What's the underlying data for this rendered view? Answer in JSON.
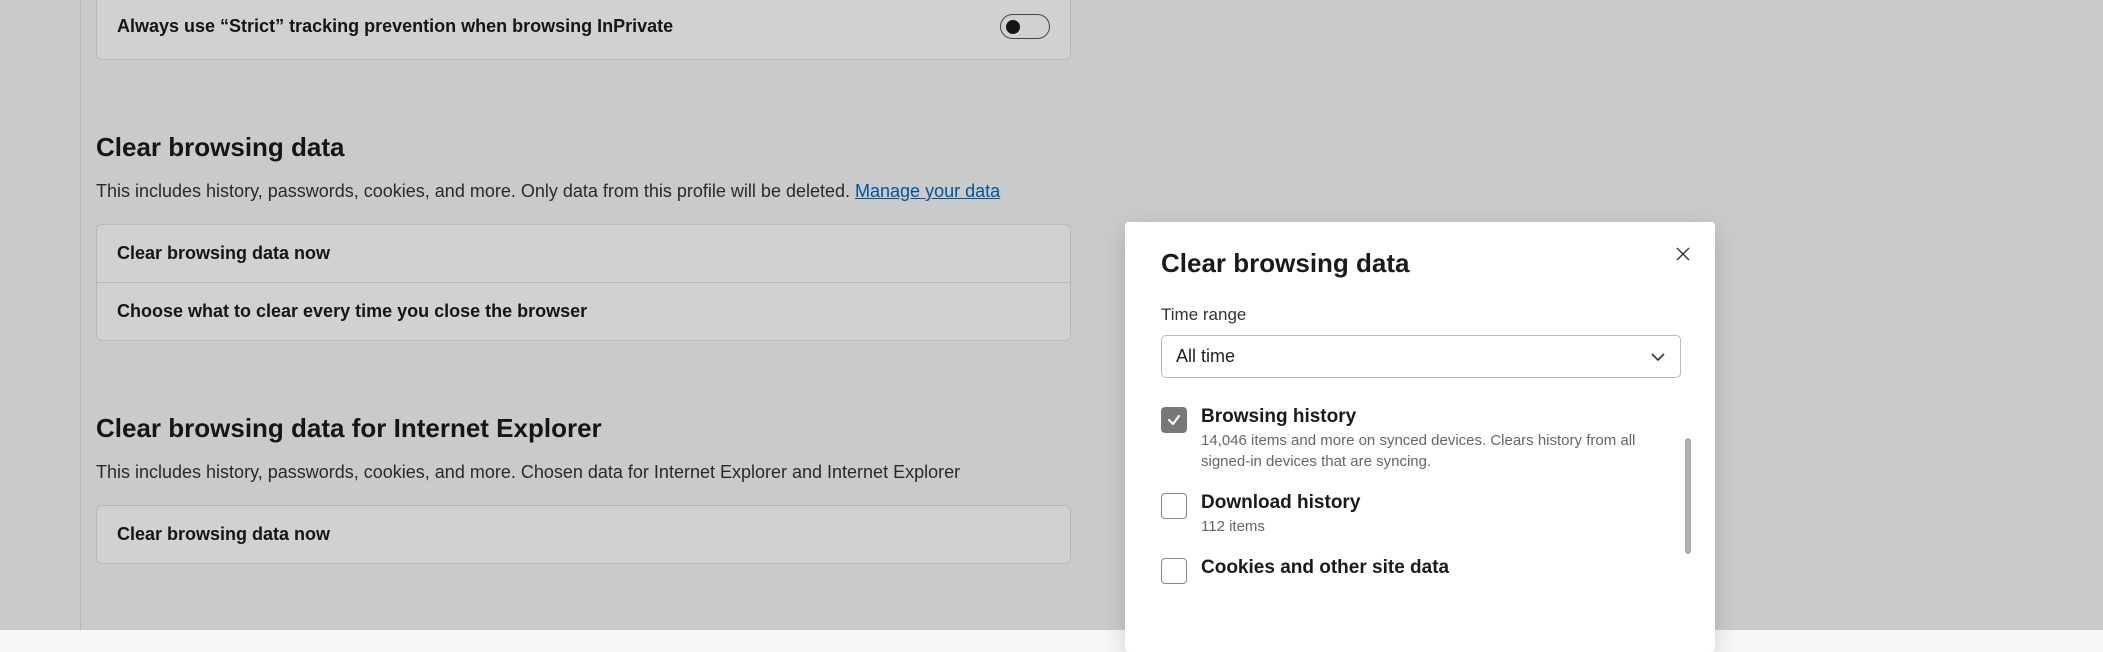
{
  "tracking": {
    "inprivate_strict_label": "Always use “Strict” tracking prevention when browsing InPrivate"
  },
  "clear_section": {
    "title": "Clear browsing data",
    "desc_prefix": "This includes history, passwords, cookies, and more. Only data from this profile will be deleted. ",
    "manage_link": "Manage your data",
    "row_now": "Clear browsing data now",
    "row_on_close": "Choose what to clear every time you close the browser"
  },
  "ie_section": {
    "title": "Clear browsing data for Internet Explorer",
    "desc": "This includes history, passwords, cookies, and more. Chosen data for Internet Explorer and Internet Explorer",
    "row_now": "Clear browsing data now"
  },
  "dialog": {
    "title": "Clear browsing data",
    "time_range_label": "Time range",
    "time_range_value": "All time",
    "items": [
      {
        "title": "Browsing history",
        "sub": "14,046 items and more on synced devices. Clears history from all signed-in devices that are syncing.",
        "checked": true
      },
      {
        "title": "Download history",
        "sub": "112 items",
        "checked": false
      },
      {
        "title": "Cookies and other site data",
        "sub": "",
        "checked": false
      }
    ]
  }
}
